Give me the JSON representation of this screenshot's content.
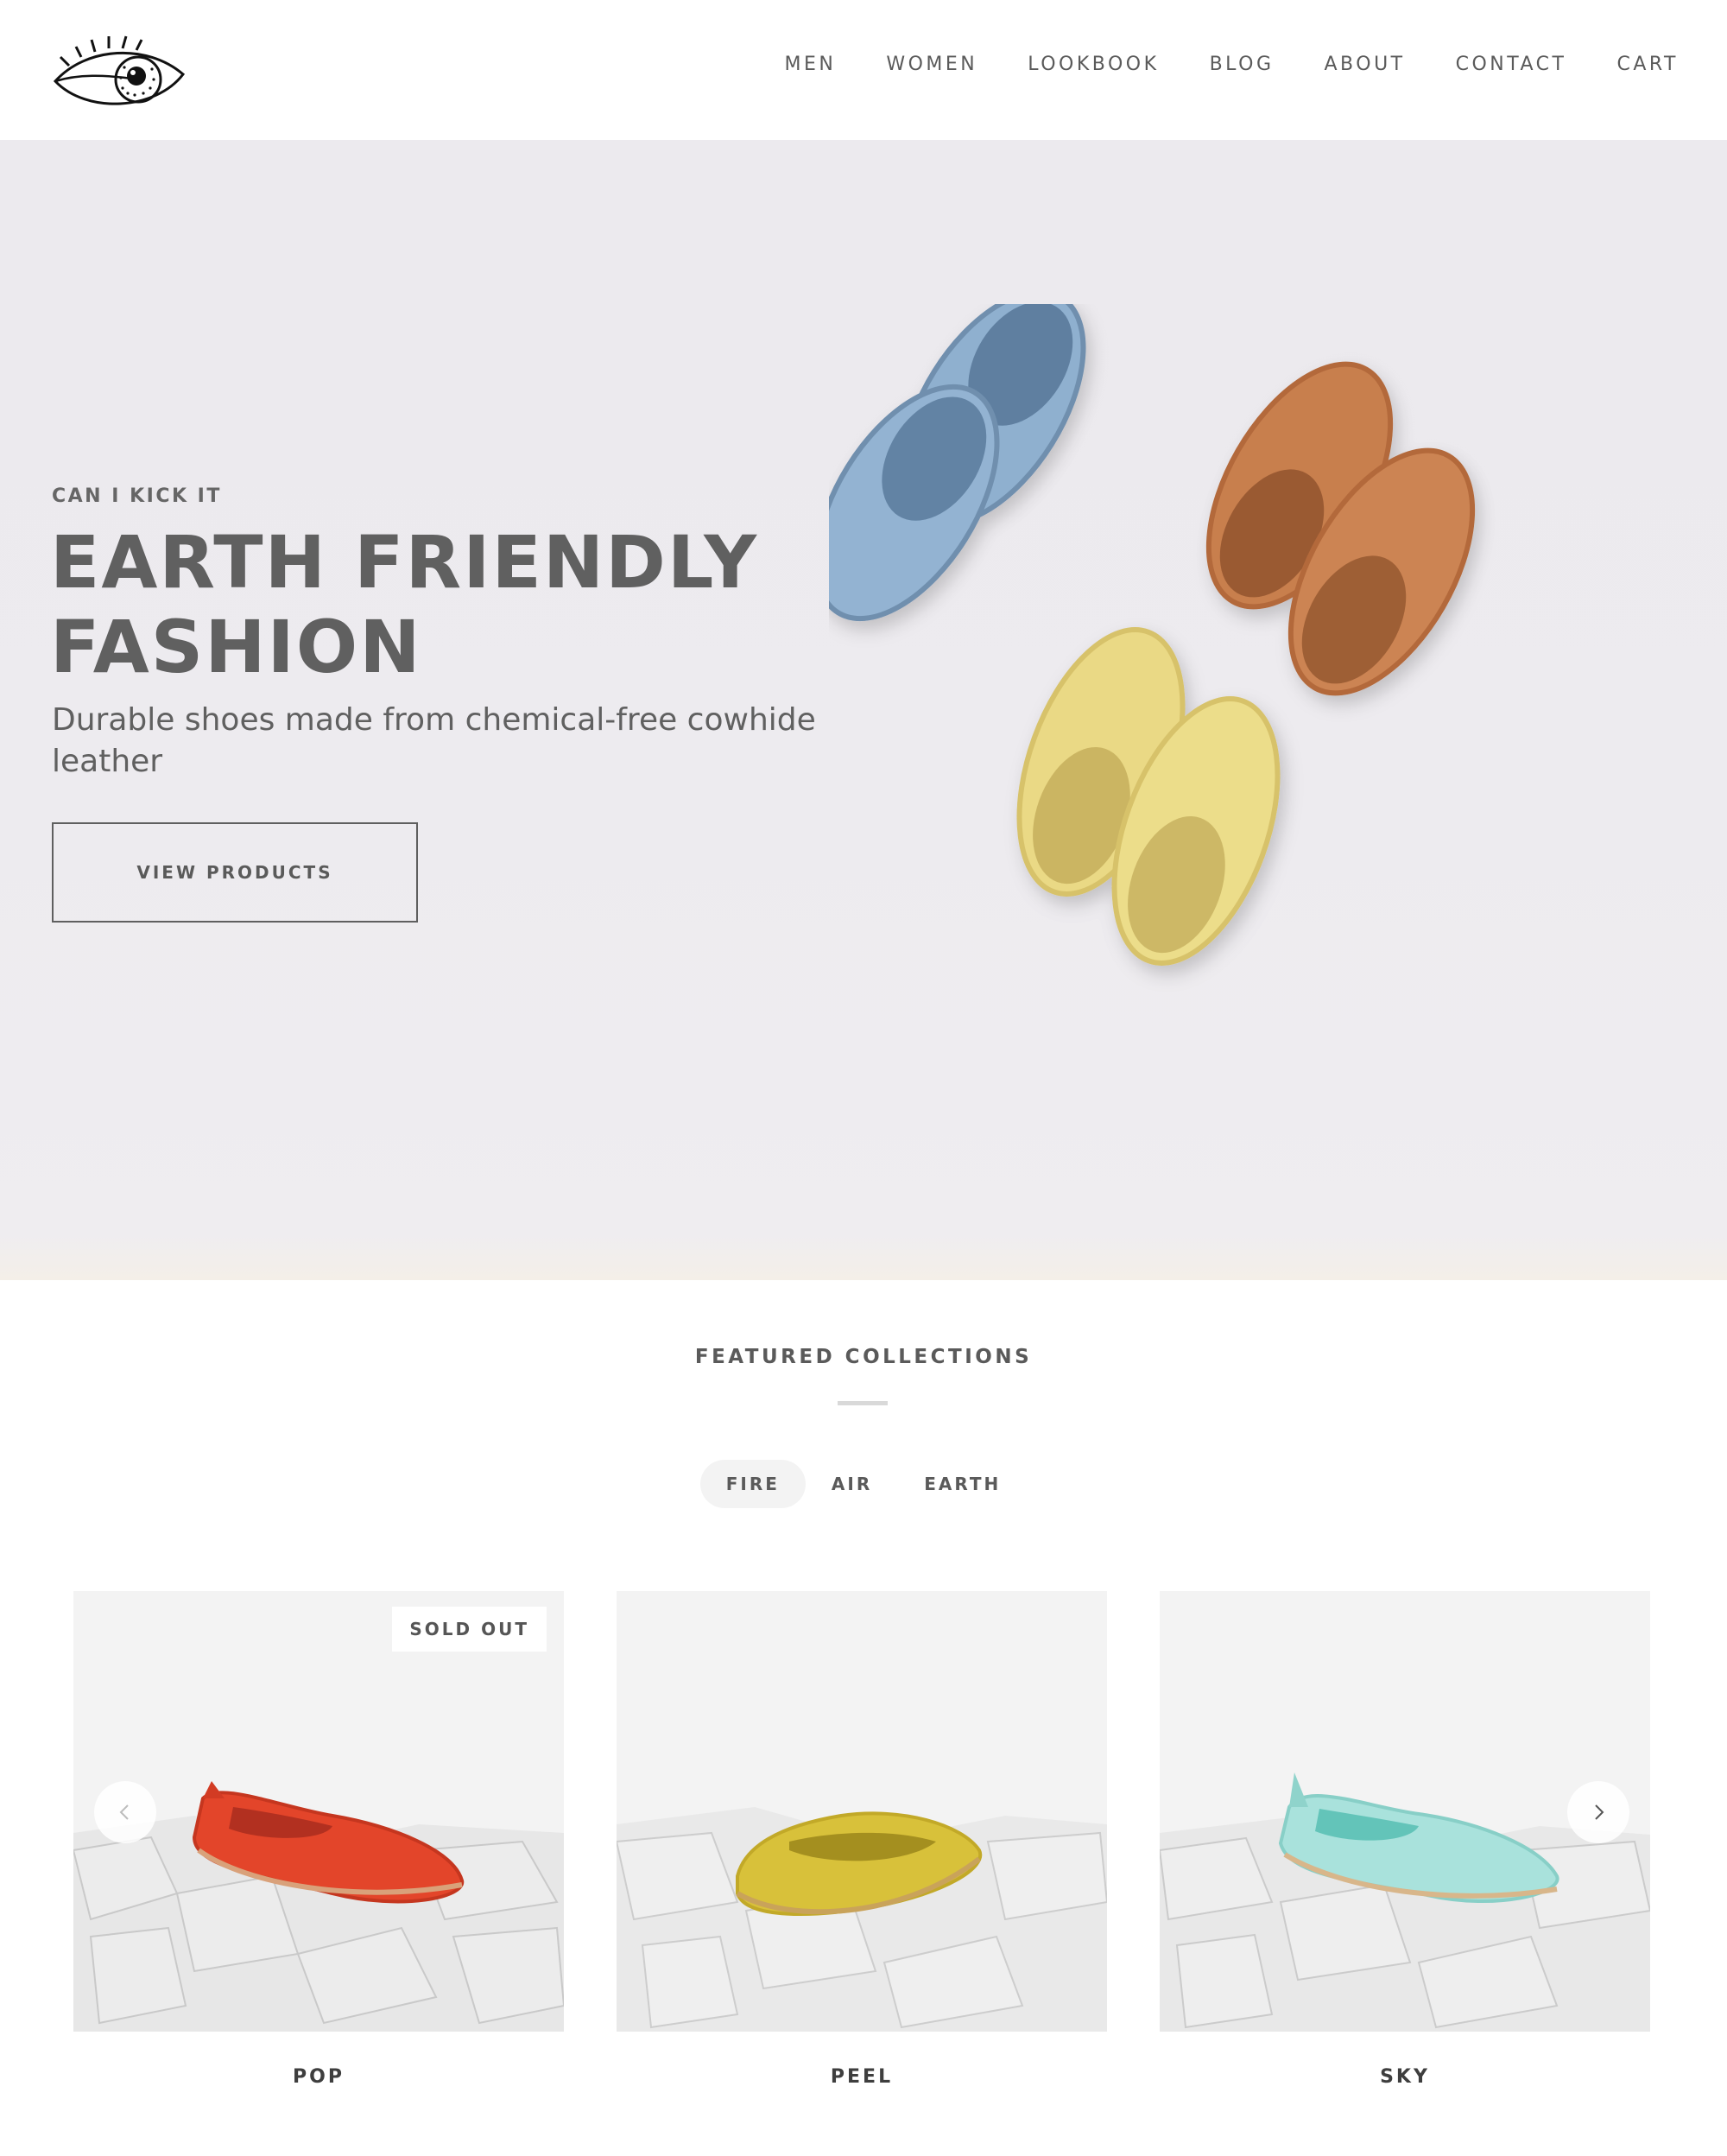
{
  "header": {
    "logo_name": "eye-logo",
    "nav": [
      "MEN",
      "WOMEN",
      "LOOKBOOK",
      "BLOG",
      "ABOUT",
      "CONTACT",
      "CART"
    ]
  },
  "hero": {
    "eyebrow": "CAN I KICK IT",
    "title_line1": "EARTH FRIENDLY",
    "title_line2": "FASHION",
    "subtitle": "Durable shoes made from chemical-free cowhide leather",
    "cta": "VIEW PRODUCTS"
  },
  "featured": {
    "title": "FEATURED COLLECTIONS",
    "tabs": [
      "FIRE",
      "AIR",
      "EARTH"
    ],
    "active_tab": "FIRE",
    "products": [
      {
        "name": "POP",
        "badge": "SOLD OUT",
        "color": "#e3452a"
      },
      {
        "name": "PEEL",
        "badge": "",
        "color": "#d8c13a"
      },
      {
        "name": "SKY",
        "badge": "",
        "color": "#a9e2dc"
      }
    ]
  },
  "colors": {
    "text": "#5b5b5b",
    "hero_bg": "#edebef",
    "blue_shoe": "#8fb0cf",
    "tan_shoe": "#c87f4e",
    "yellow_shoe": "#e8d982"
  }
}
